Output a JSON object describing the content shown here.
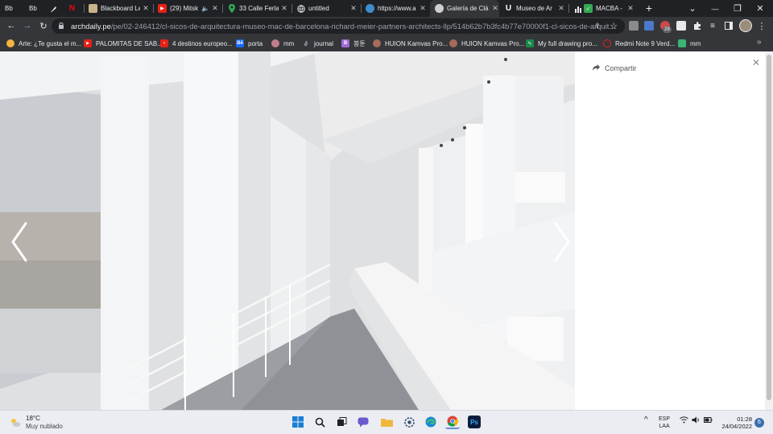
{
  "browser": {
    "tabs": [
      {
        "title": "Bb",
        "favicon": "",
        "close": "",
        "active": false
      },
      {
        "title": "Bb",
        "favicon": "",
        "close": "",
        "active": false
      },
      {
        "title": "",
        "favicon": "",
        "close": "",
        "active": false
      },
      {
        "title": "",
        "favicon": "N",
        "close": "",
        "active": false
      },
      {
        "title": "Blackboard Le",
        "favicon": "",
        "close": "✕",
        "active": false
      },
      {
        "title": "(29) Mitsk",
        "favicon": "▶",
        "close": "✕",
        "active": false
      },
      {
        "title": "33 Calle Ferla",
        "favicon": "",
        "close": "✕",
        "active": false
      },
      {
        "title": "untitled",
        "favicon": "",
        "close": "✕",
        "active": false
      },
      {
        "title": "https://www.a",
        "favicon": "",
        "close": "✕",
        "active": false
      },
      {
        "title": "Galería de Clá",
        "favicon": "",
        "close": "✕",
        "active": true
      },
      {
        "title": "Museo de Ar",
        "favicon": "U",
        "close": "✕",
        "active": false
      },
      {
        "title": "MACBA - ",
        "favicon": "",
        "close": "✕",
        "active": false
      }
    ],
    "new_tab_label": "+",
    "window_controls": {
      "dropdown": "⌄",
      "minimize": "—",
      "restore": "❐",
      "close": "✕"
    },
    "toolbar": {
      "back": "←",
      "forward": "→",
      "reload": "↻",
      "url_host": "archdaily.pe",
      "url_path": "/pe/02-246412/cl-sicos-de-arquitectura-museo-mac-de-barcelona-richard-meier-partners-architects-llp/514b62b7b3fc4b77e70000f1-cl-sicos-de-arquit...",
      "extension_badge": "29",
      "menu": "⋮"
    },
    "bookmarks": [
      {
        "label": "Arte: ¿Te gusta el m...",
        "icon_color": "#f2b43c"
      },
      {
        "label": "PALOMITAS DE SAB...",
        "icon_color": "#e62117"
      },
      {
        "label": "4 destinos europeo...",
        "icon_color": "#e62117"
      },
      {
        "label": "porta",
        "icon_color": "#1769ff",
        "icon_text": "Bē"
      },
      {
        "label": "mm",
        "icon_color": "#c17d8c"
      },
      {
        "label": "journal",
        "icon_color": "#8a8a8a"
      },
      {
        "label": "봉툰",
        "icon_color": "#a06ad8",
        "icon_text": "B"
      },
      {
        "label": "HUION Kamvas Pro...",
        "icon_color": "#a86a5a"
      },
      {
        "label": "HUION Kamvas Pro...",
        "icon_color": "#a86a5a"
      },
      {
        "label": "My full drawing pro...",
        "icon_color": "#1a8a4a"
      },
      {
        "label": "Redmi Note 9 Verd...",
        "icon_color": "#e62117"
      },
      {
        "label": "mm",
        "icon_color": "#3cb371"
      }
    ],
    "bookmarks_more": "»"
  },
  "gallery": {
    "prev_arrow": "‹",
    "next_arrow": "›",
    "share_label": "Compartir",
    "close_label": "✕"
  },
  "taskbar": {
    "weather_temp": "18°C",
    "weather_condition": "Muy nublado",
    "lang_top": "ESP",
    "lang_bottom": "LAA",
    "time": "01:28",
    "date": "24/04/2022",
    "notification_count": "6",
    "tray_chevron": "^"
  }
}
